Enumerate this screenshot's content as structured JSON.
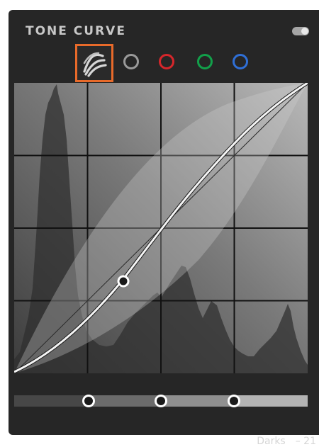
{
  "panel": {
    "title": "TONE CURVE",
    "enabled": true
  },
  "channels": [
    {
      "name": "parametric-icon",
      "selected": true,
      "color": "#e86a2a"
    },
    {
      "name": "rgb-point-curve",
      "selected": false,
      "color": "#9a9a9a"
    },
    {
      "name": "red-channel",
      "selected": false,
      "color": "#d6262b"
    },
    {
      "name": "green-channel",
      "selected": false,
      "color": "#12a04a"
    },
    {
      "name": "blue-channel",
      "selected": false,
      "color": "#2f6fd6"
    }
  ],
  "readout": {
    "region": "Darks",
    "value": "– 21"
  },
  "region_splits": {
    "shadows_darks": 25,
    "darks_lights": 50,
    "lights_highlights": 75
  }
}
